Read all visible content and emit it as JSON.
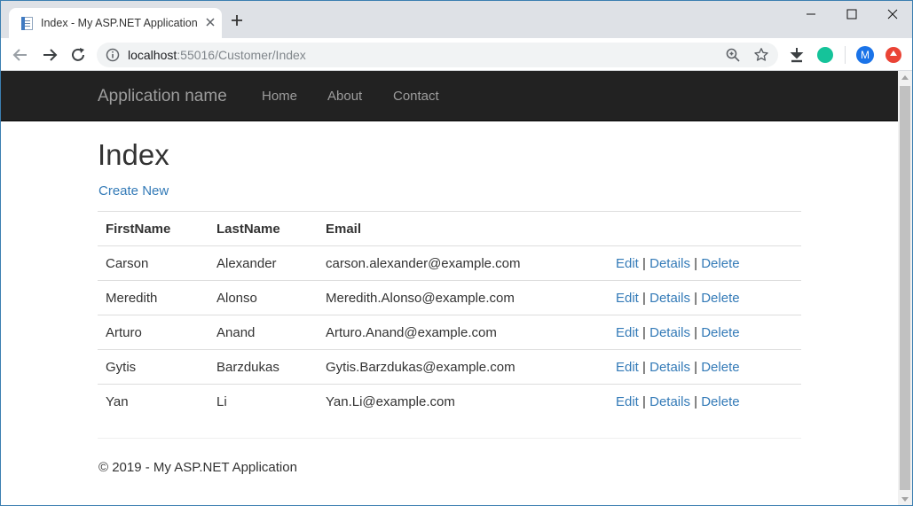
{
  "browser": {
    "tab_title": "Index - My ASP.NET Application",
    "url_host": "localhost",
    "url_port": ":55016",
    "url_path": "/Customer/Index",
    "profile_initial": "M",
    "accent": "#1a73e8"
  },
  "navbar": {
    "brand": "Application name",
    "links": [
      "Home",
      "About",
      "Contact"
    ]
  },
  "page": {
    "title": "Index",
    "create_link": "Create New"
  },
  "table": {
    "headers": [
      "FirstName",
      "LastName",
      "Email"
    ],
    "rows": [
      {
        "first": "Carson",
        "last": "Alexander",
        "email": "carson.alexander@example.com"
      },
      {
        "first": "Meredith",
        "last": "Alonso",
        "email": "Meredith.Alonso@example.com"
      },
      {
        "first": "Arturo",
        "last": "Anand",
        "email": "Arturo.Anand@example.com"
      },
      {
        "first": "Gytis",
        "last": "Barzdukas",
        "email": "Gytis.Barzdukas@example.com"
      },
      {
        "first": "Yan",
        "last": "Li",
        "email": "Yan.Li@example.com"
      }
    ],
    "actions": {
      "edit": "Edit",
      "details": "Details",
      "delete": "Delete",
      "separator": "|"
    }
  },
  "footer": {
    "text": "© 2019 - My ASP.NET Application"
  },
  "colors": {
    "navbar_bg": "#222222",
    "link": "#337ab7",
    "text": "#333333"
  }
}
